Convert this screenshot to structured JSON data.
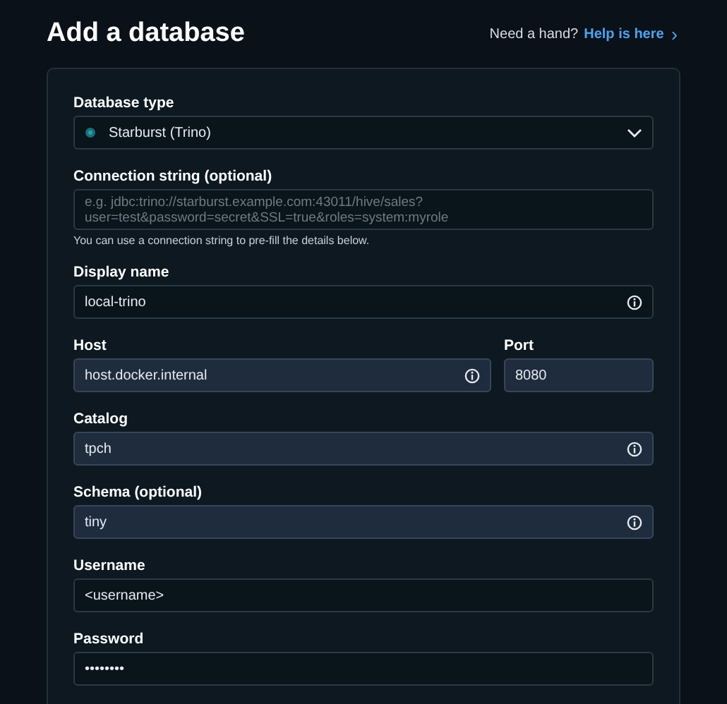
{
  "title": "Add a database",
  "help": {
    "prompt": "Need a hand?",
    "link": "Help is here",
    "chevron": "›"
  },
  "fields": [
    {
      "kind": "select",
      "label": "Database type",
      "value": "Starburst (Trino)"
    },
    {
      "kind": "textarea",
      "label": "Connection string (optional)",
      "placeholder": "e.g. jdbc:trino://starburst.example.com:43011/hive/sales?\nuser=test&password=secret&SSL=true&roles=system:myrole",
      "hint": "You can use a connection string to pre-fill the details below."
    },
    {
      "kind": "text",
      "label": "Display name",
      "value": "local-trino",
      "info": true,
      "autofilled": false
    },
    {
      "kind": "row",
      "fields": [
        {
          "kind": "text",
          "label": "Host",
          "value": "host.docker.internal",
          "info": true,
          "autofilled": true
        },
        {
          "kind": "text",
          "label": "Port",
          "value": "8080",
          "info": false,
          "autofilled": true
        }
      ]
    },
    {
      "kind": "text",
      "label": "Catalog",
      "value": "tpch",
      "info": true,
      "autofilled": true
    },
    {
      "kind": "text",
      "label": "Schema (optional)",
      "value": "tiny",
      "info": true,
      "autofilled": true
    },
    {
      "kind": "text",
      "label": "Username",
      "value": "<username>",
      "info": false,
      "autofilled": false
    },
    {
      "kind": "text",
      "label": "Password",
      "value": "••••••••",
      "info": false,
      "autofilled": false
    }
  ]
}
